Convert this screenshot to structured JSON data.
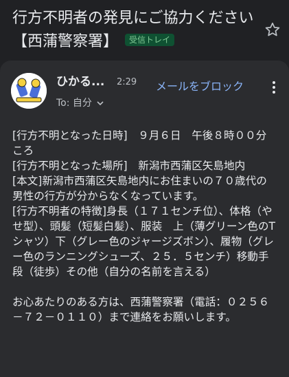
{
  "subject": {
    "title": "行方不明者の発見にご協力ください【西蒲警察署】",
    "label": "受信トレイ"
  },
  "icons": {
    "star": "star-outline-icon",
    "more": "more-vert-icon",
    "chevron": "chevron-down-icon"
  },
  "message": {
    "sender": "ひかる...",
    "time": "2:29",
    "block_label": "メールをブロック",
    "to_label": "To: 自分",
    "lines": [
      "[行方不明となった日時]　９月６日　午後８時００分ころ",
      "[行方不明となった場所]　新潟市西蒲区矢島地内",
      "[本文]新潟市西蒲区矢島地内にお住まいの７０歳代の男性の行方が分からなくなっています。",
      "[行方不明者の特徴]身長（１７１センチ位）、体格（やせ型）、頭髪（短髪白髪）、服装　上（薄グリーン色のTシャツ）下（グレー色のジャージズボン）、履物（グレー色のランニングシューズ、２５．５センチ）移動手段（徒歩）その他（自分の名前を言える）",
      "お心あたりのある方は、西蒲警察署（電話：０２５６－７２－０１１０）まで連絡をお願いします。"
    ]
  },
  "colors": {
    "background": "#202124",
    "card": "#2b2c2f",
    "link": "#8ab4f8",
    "label_bg": "#0f5132",
    "label_text": "#81c995"
  }
}
